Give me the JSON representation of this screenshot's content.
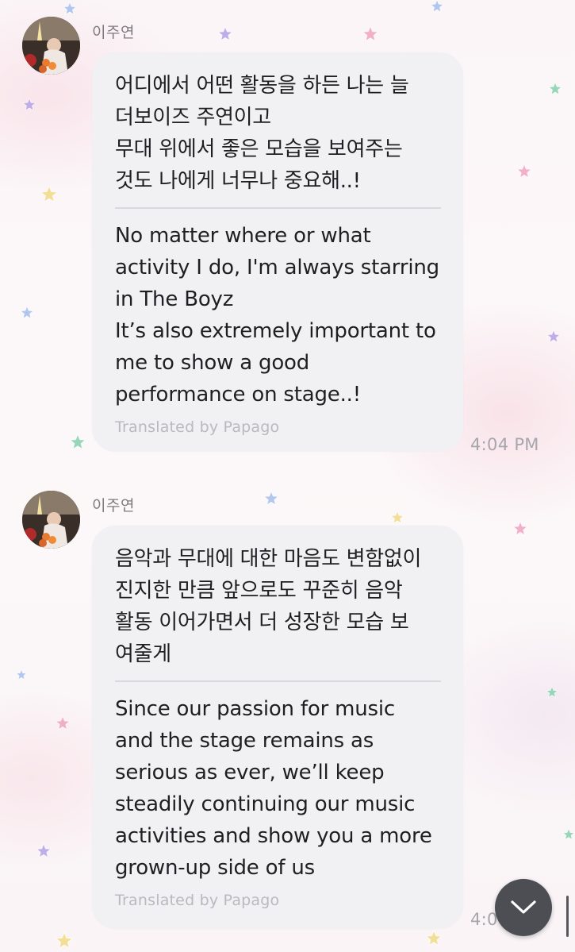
{
  "messages": [
    {
      "sender": "이주연",
      "original": "어디에서 어떤 활동을 하든 나는 늘\n더보이즈 주연이고\n무대 위에서 좋은 모습을 보여주는\n것도 나에게 너무나 중요해..!",
      "translated": "No matter where or what\nactivity I do, I'm always starring\nin The Boyz\nIt’s also extremely important to\nme to show a good\nperformance on stage..!",
      "credit": "Translated by Papago",
      "time": "4:04 PM"
    },
    {
      "sender": "이주연",
      "original": "음악과 무대에 대한 마음도 변함없이\n진지한 만큼 앞으로도 꾸준히 음악\n활동 이어가면서 더 성장한 모습 보\n여줄게",
      "translated": "Since our passion for music\nand the stage remains as\nserious as ever, we’ll keep\nsteadily continuing our music\nactivities and show you a more\ngrown-up side of us",
      "credit": "Translated by Papago",
      "time": "4:0"
    }
  ],
  "icons": {
    "scroll_down": "chevron-down-icon",
    "decoration": "star-icon"
  },
  "colors": {
    "bubble": "#f1f1f4",
    "scroll_button": "#4d4e54",
    "star_blue": "#a9c2ee",
    "star_purple": "#b9a6e8",
    "star_pink": "#f0a8c4",
    "star_green": "#8fd3b3",
    "star_yellow": "#f3dc8e"
  }
}
